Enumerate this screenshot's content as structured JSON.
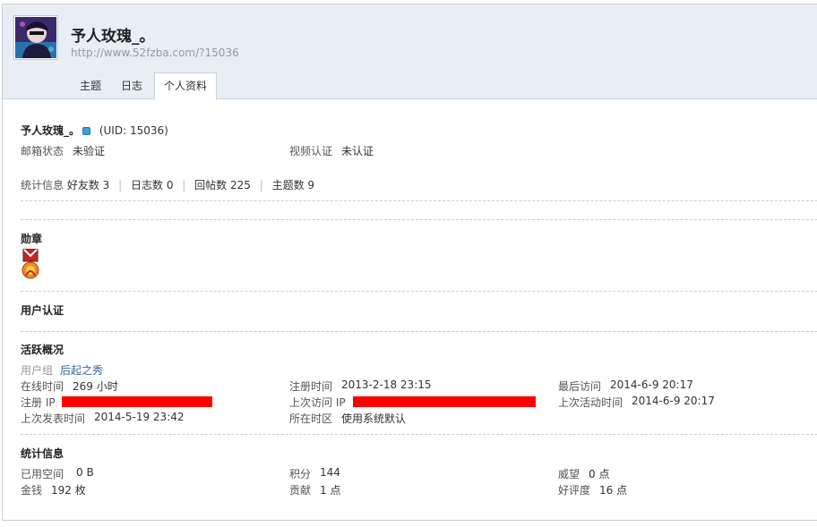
{
  "profile": {
    "name": "予人玫瑰_。",
    "url": "http://www.52fzba.com/?15036",
    "uid_text": "(UID: 15036)"
  },
  "tabs": [
    {
      "label": "主题",
      "active": false
    },
    {
      "label": "日志",
      "active": false
    },
    {
      "label": "个人资料",
      "active": true
    }
  ],
  "basic": {
    "email_label": "邮箱状态",
    "email_value": "未验证",
    "video_label": "视频认证",
    "video_value": "未认证"
  },
  "stats_line": {
    "label": "统计信息",
    "friends": "好友数 3",
    "blogs": "日志数 0",
    "replies": "回帖数 225",
    "threads": "主题数 9",
    "separator": "|"
  },
  "medals": {
    "title": "勋章",
    "icon": "medal-icon"
  },
  "verify": {
    "title": "用户认证"
  },
  "activity": {
    "title": "活跃概况",
    "usergroup_label": "用户组",
    "usergroup_value": "后起之秀",
    "online_label": "在线时间",
    "online_value": "269 小时",
    "reg_time_label": "注册时间",
    "reg_time_value": "2013-2-18 23:15",
    "last_visit_label": "最后访问",
    "last_visit_value": "2014-6-9 20:17",
    "reg_ip_label": "注册 IP",
    "last_ip_label": "上次访问 IP",
    "last_active_label": "上次活动时间",
    "last_active_value": "2014-6-9 20:17",
    "last_post_label": "上次发表时间",
    "last_post_value": "2014-5-19 23:42",
    "timezone_label": "所在时区",
    "timezone_value": "使用系统默认"
  },
  "statistics": {
    "title": "统计信息",
    "space_label": "已用空间",
    "space_value": "0 B",
    "credits_label": "积分",
    "credits_value": "144",
    "prestige_label": "威望",
    "prestige_value": "0 点",
    "money_label": "金钱",
    "money_value": "192 枚",
    "contrib_label": "贡献",
    "contrib_value": "1 点",
    "rating_label": "好评度",
    "rating_value": "16 点"
  },
  "colors": {
    "header_bg": "#e8eef4",
    "link": "#336699",
    "redaction": "#ff0000",
    "online_indicator": "#3aa0d8"
  }
}
